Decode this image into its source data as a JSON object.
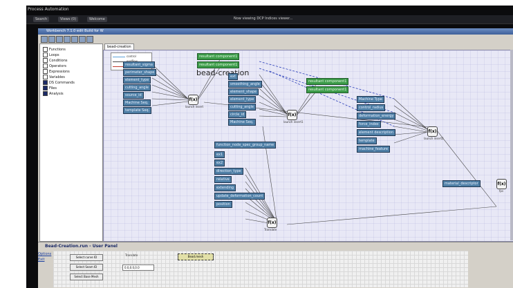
{
  "os": {
    "title": "Process Automation",
    "tabs": [
      "Search",
      "Views (0)",
      "Welcome"
    ],
    "status": "Now viewing DCP Indices viewer..."
  },
  "app": {
    "title": "Workbench 7.1.0 edit Build for W"
  },
  "tree": {
    "items": [
      "Functions",
      "Loops",
      "Conditions",
      "Operators",
      "Expressions",
      "Variables",
      "DS Commands",
      "Files",
      "Analysis"
    ]
  },
  "canvas": {
    "tab": "bead-creation",
    "title": "bead-creation",
    "legend": [
      "control",
      "endflow",
      "user input"
    ],
    "nodes_left": [
      "resultant_sigma",
      "perimeter_shape",
      "element_type",
      "cutting_angle",
      "source_id",
      "Machine Seq.",
      "template Seq."
    ],
    "nodes_top_green": [
      "resultant component1",
      "resultant component1"
    ],
    "nodes_mid": [
      "ext",
      "smoothing_angle",
      "element_shape",
      "element_type",
      "cutting_angle",
      "circle_id",
      "Machine Seq."
    ],
    "nodes_right_green": [
      "resultant component1",
      "resultant component1"
    ],
    "nodes_far_right": [
      "Machine Type",
      "control_radius",
      "deformation_energy",
      "force_index",
      "element description",
      "template",
      "machine_feature"
    ],
    "nodes_lower": [
      "function_node_spec_group_name",
      "ex1",
      "ex2",
      "direction_type",
      "relative",
      "extending",
      "update_deformation_count",
      "position"
    ],
    "node_far_far": "material_descriptor",
    "fx_labels": [
      "launch insert",
      "launch insert1",
      "launch insert2",
      "Translate",
      "fps"
    ],
    "fx_symbol": "f(x)"
  },
  "panel": {
    "title": "Bead-Creation.run - User Panel",
    "nav": [
      "Options",
      "Exit"
    ],
    "buttons": [
      "Select curve ID",
      "Select Seam ID",
      "Select Base Mesh"
    ],
    "translate_label": "Translate",
    "translate_value": "0.0,0.0,0.0",
    "selected_item": "Bead.mesh"
  }
}
